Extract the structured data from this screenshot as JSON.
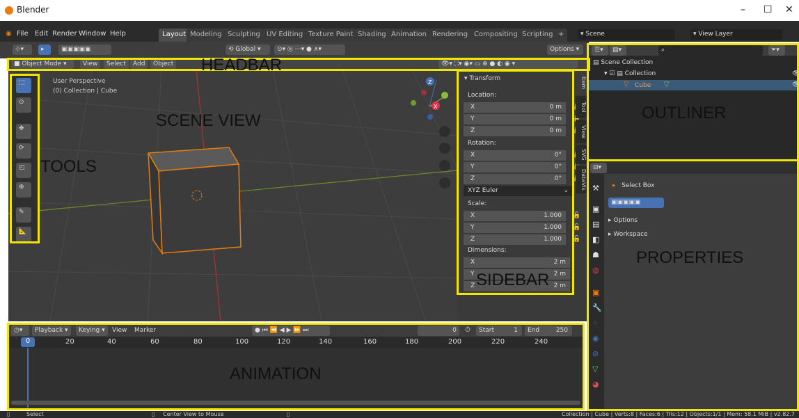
{
  "app": {
    "title": "Blender"
  },
  "menus": [
    "File",
    "Edit",
    "Render",
    "Window",
    "Help"
  ],
  "workspaces": [
    "Layout",
    "Modeling",
    "Sculpting",
    "UV Editing",
    "Texture Paint",
    "Shading",
    "Animation",
    "Rendering",
    "Compositing",
    "Scripting"
  ],
  "scene": {
    "name": "Scene",
    "view_layer": "View Layer"
  },
  "toolheader": {
    "orientation": "Global",
    "options": "Options"
  },
  "viewport_header": {
    "mode": "Object Mode",
    "menus": [
      "View",
      "Select",
      "Add",
      "Object"
    ]
  },
  "viewport": {
    "perspective": "User Perspective",
    "collection": "(0) Collection | Cube"
  },
  "sidebar": {
    "panel": "Transform",
    "location_label": "Location:",
    "location": [
      {
        "k": "X",
        "v": "0 m"
      },
      {
        "k": "Y",
        "v": "0 m"
      },
      {
        "k": "Z",
        "v": "0 m"
      }
    ],
    "rotation_label": "Rotation:",
    "rotation": [
      {
        "k": "X",
        "v": "0°"
      },
      {
        "k": "Y",
        "v": "0°"
      },
      {
        "k": "Z",
        "v": "0°"
      }
    ],
    "rotation_mode": "XYZ Euler",
    "scale_label": "Scale:",
    "scale": [
      {
        "k": "X",
        "v": "1.000"
      },
      {
        "k": "Y",
        "v": "1.000"
      },
      {
        "k": "Z",
        "v": "1.000"
      }
    ],
    "dimensions_label": "Dimensions:",
    "dimensions": [
      {
        "k": "X",
        "v": "2 m"
      },
      {
        "k": "Y",
        "v": "2 m"
      },
      {
        "k": "Z",
        "v": "2 m"
      }
    ],
    "tabs": [
      "Item",
      "Tool",
      "View",
      "SVG",
      "DataVis"
    ]
  },
  "outliner": {
    "root": "Scene Collection",
    "collection": "Collection",
    "object": "Cube"
  },
  "properties": {
    "tool": "Select Box",
    "sections": [
      "Options",
      "Workspace"
    ]
  },
  "timeline": {
    "menus": [
      "Playback",
      "Keying",
      "View",
      "Marker"
    ],
    "current": "0",
    "start_label": "Start",
    "start": "1",
    "end_label": "End",
    "end": "250",
    "ticks": [
      "0",
      "20",
      "40",
      "60",
      "80",
      "100",
      "120",
      "140",
      "160",
      "180",
      "200",
      "220",
      "240"
    ]
  },
  "status": {
    "left": "Select",
    "middle": "Center View to Mouse",
    "right": "Collection | Cube | Verts:8 | Faces:6 | Tris:12 | Objects:1/1 | Mem: 58.1 MiB | v2.82.7"
  },
  "labels": {
    "headbar": "HEADBAR",
    "scene_view": "SCENE VIEW",
    "tools": "TOOLS",
    "outliner": "OUTLINER",
    "properties": "PROPERTIES",
    "sidebar": "SIDEBAR",
    "animation": "ANIMATION"
  },
  "colors": {
    "highlight": "#f2e500",
    "accent": "#e87d0d",
    "active": "#4772b3"
  }
}
